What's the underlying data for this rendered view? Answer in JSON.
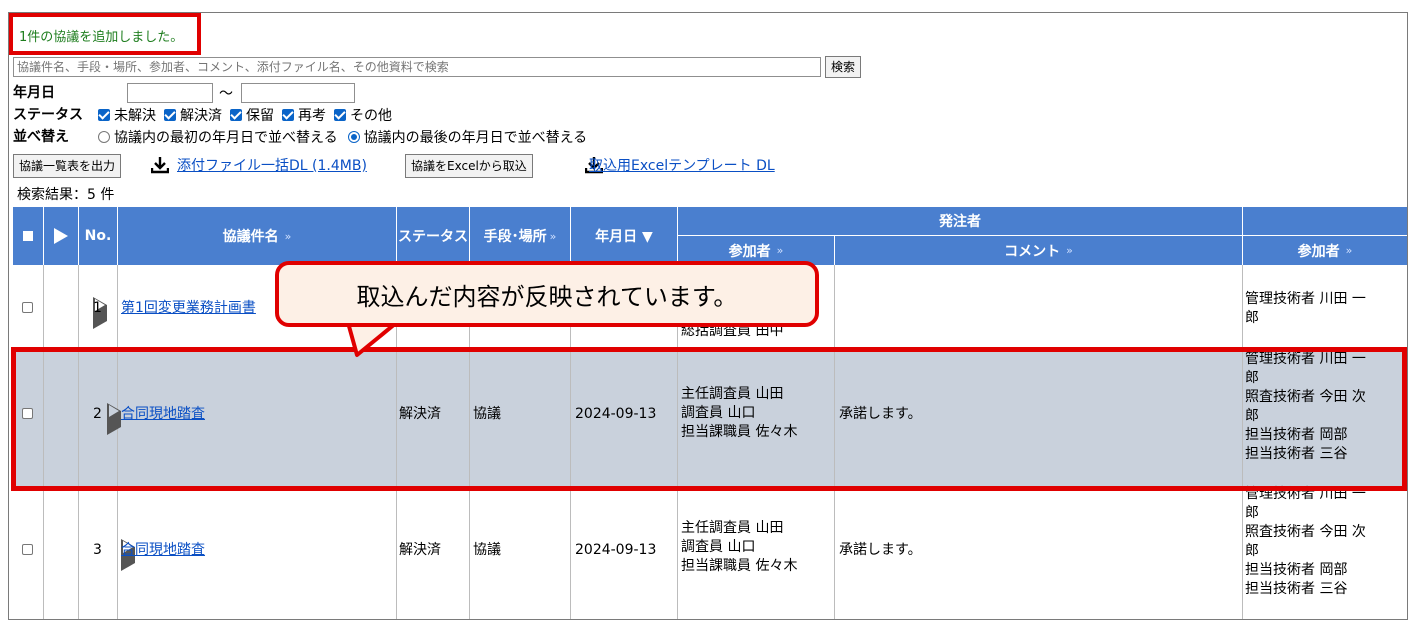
{
  "message": "1件の協議を追加しました。",
  "search": {
    "placeholder": "協議件名、手段・場所、参加者、コメント、添付ファイル名、その他資料で検索",
    "button": "検索"
  },
  "filters": {
    "date_label": "年月日",
    "date_sep": "～",
    "status_label": "ステータス",
    "status_options": [
      "未解決",
      "解決済",
      "保留",
      "再考",
      "その他"
    ],
    "sort_label": "並べ替え",
    "sort_options": [
      "協議内の最初の年月日で並べ替える",
      "協議内の最後の年月日で並べ替える"
    ]
  },
  "actions": {
    "export_list": "協議一覧表を出力",
    "attach_dl": "添付ファイル一括DL (1.4MB)",
    "import_excel": "協議をExcelから取込",
    "template_dl": "取込用Excelテンプレート DL"
  },
  "result_count": "検索結果：5 件",
  "table": {
    "headers": {
      "no": "No.",
      "title": "協議件名",
      "status": "ステータス",
      "method": "手段･場所",
      "date": "年月日 ▼",
      "orderer_group": "発注者",
      "orderer_participants": "参加者",
      "orderer_comment": "コメント",
      "contractor_participants": "参加者",
      "sort_mark": "»"
    },
    "rows": [
      {
        "no": "1",
        "title": "第1回変更業務計画書",
        "status": "",
        "method": "",
        "date": "",
        "participants": [
          "総括調査員 田中"
        ],
        "comment": "",
        "contractor": [
          "管理技術者 川田 一",
          "郎"
        ]
      },
      {
        "no": "2",
        "title": "合同現地踏査",
        "status": "解決済",
        "method": "協議",
        "date": "2024-09-13",
        "participants": [
          "主任調査員 山田",
          "調査員 山口",
          "担当課職員 佐々木"
        ],
        "comment": "承諾します。",
        "contractor": [
          "管理技術者 川田 一",
          "郎",
          "照査技術者 今田 次",
          "郎",
          "担当技術者 岡部",
          "担当技術者 三谷"
        ]
      },
      {
        "no": "3",
        "title": "合同現地踏査",
        "status": "解決済",
        "method": "協議",
        "date": "2024-09-13",
        "participants": [
          "主任調査員 山田",
          "調査員 山口",
          "担当課職員 佐々木"
        ],
        "comment": "承諾します。",
        "contractor": [
          "管理技術者 川田 一",
          "郎",
          "照査技術者 今田 次",
          "郎",
          "担当技術者 岡部",
          "担当技術者 三谷"
        ]
      }
    ]
  },
  "callout": "取込んだ内容が反映されています。",
  "colors": {
    "header_bg": "#4a7fcf",
    "highlight_border": "#e00000",
    "selected_row": "#c9d1dc",
    "link": "#0a4fc4",
    "message": "#1d7d1d"
  }
}
